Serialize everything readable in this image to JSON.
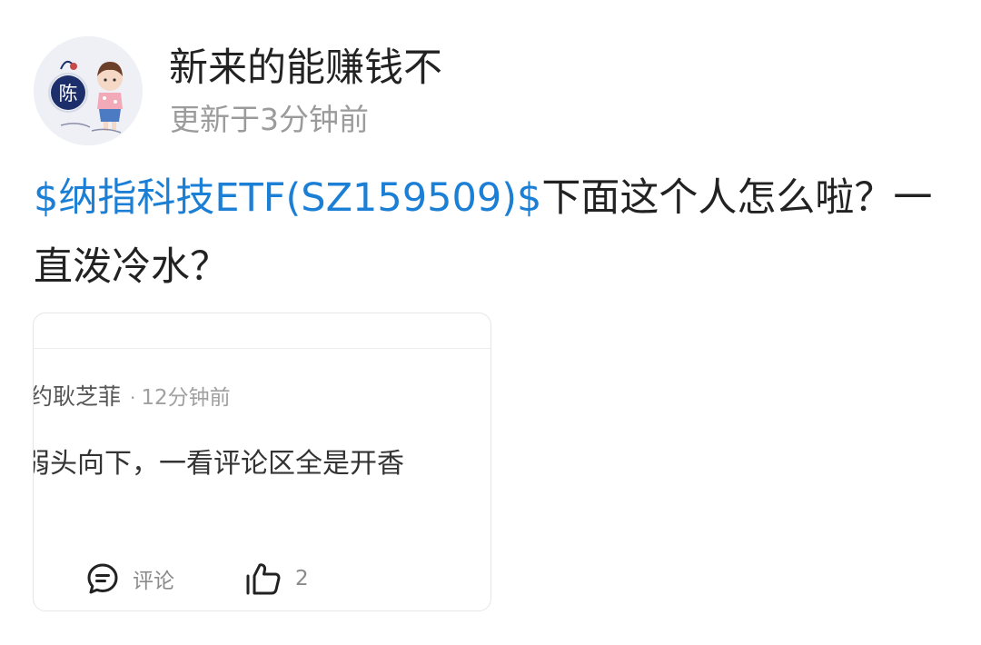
{
  "author": {
    "name": "新来的能赚钱不",
    "update_time": "更新于3分钟前",
    "avatar": {
      "badge_text": "陈",
      "accent": "#1d2f6b"
    }
  },
  "post": {
    "tag": "$纳指科技ETF(SZ159509)$",
    "tag_color": "#1b7fd6",
    "body": "下面这个人怎么啦？一直泼冷水？"
  },
  "quoted_comment": {
    "user": "约耿芝菲",
    "separator": "·",
    "time": "12分钟前",
    "text": "弱头向下，一看评论区全是开香",
    "actions": {
      "comment_label": "评论",
      "comment_icon": "comment-bubble-icon",
      "like_count": "2",
      "like_icon": "thumbs-up-icon"
    }
  }
}
